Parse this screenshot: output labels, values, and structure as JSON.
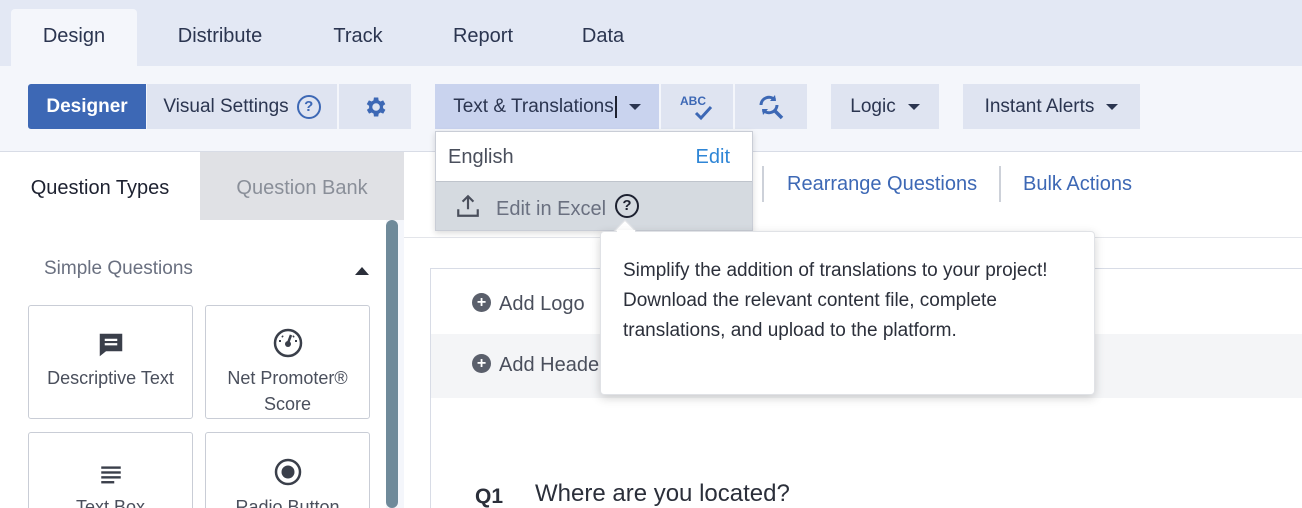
{
  "top_tabs": [
    {
      "label": "Design",
      "active": true
    },
    {
      "label": "Distribute"
    },
    {
      "label": "Track"
    },
    {
      "label": "Report"
    },
    {
      "label": "Data"
    }
  ],
  "toolbar": {
    "designer": "Designer",
    "visual_settings": "Visual Settings",
    "text_translations": "Text & Translations",
    "logic": "Logic",
    "instant_alerts": "Instant Alerts",
    "icons": {
      "settings": "gear-icon",
      "spellcheck": "spellcheck-icon",
      "find_replace": "find-replace-icon"
    }
  },
  "left_panel": {
    "tabs": [
      "Question Types",
      "Question Bank"
    ],
    "section_title": "Simple Questions",
    "question_types": [
      {
        "label": "Descriptive Text",
        "icon": "comment-icon"
      },
      {
        "label": "Net Promoter® Score",
        "icon": "gauge-icon"
      },
      {
        "label": "Text Box",
        "icon": "text-lines-icon"
      },
      {
        "label": "Radio Button",
        "icon": "radio-button-icon"
      }
    ]
  },
  "secondary_bar": {
    "rearrange": "Rearrange Questions",
    "bulk_actions": "Bulk Actions"
  },
  "canvas": {
    "add_logo": "Add Logo",
    "add_header": "Add Heade",
    "question_number": "Q1",
    "question_text": "Where are you located?"
  },
  "dropdown": {
    "language": "English",
    "edit": "Edit",
    "edit_in_excel": "Edit in Excel"
  },
  "tooltip": {
    "text": "Simplify the addition of translations to your project! Download the relevant content file, complete translations, and upload to the platform."
  },
  "colors": {
    "primary": "#3d68b5",
    "link": "#2f86d6",
    "tab_bar": "#e3e8f4"
  }
}
